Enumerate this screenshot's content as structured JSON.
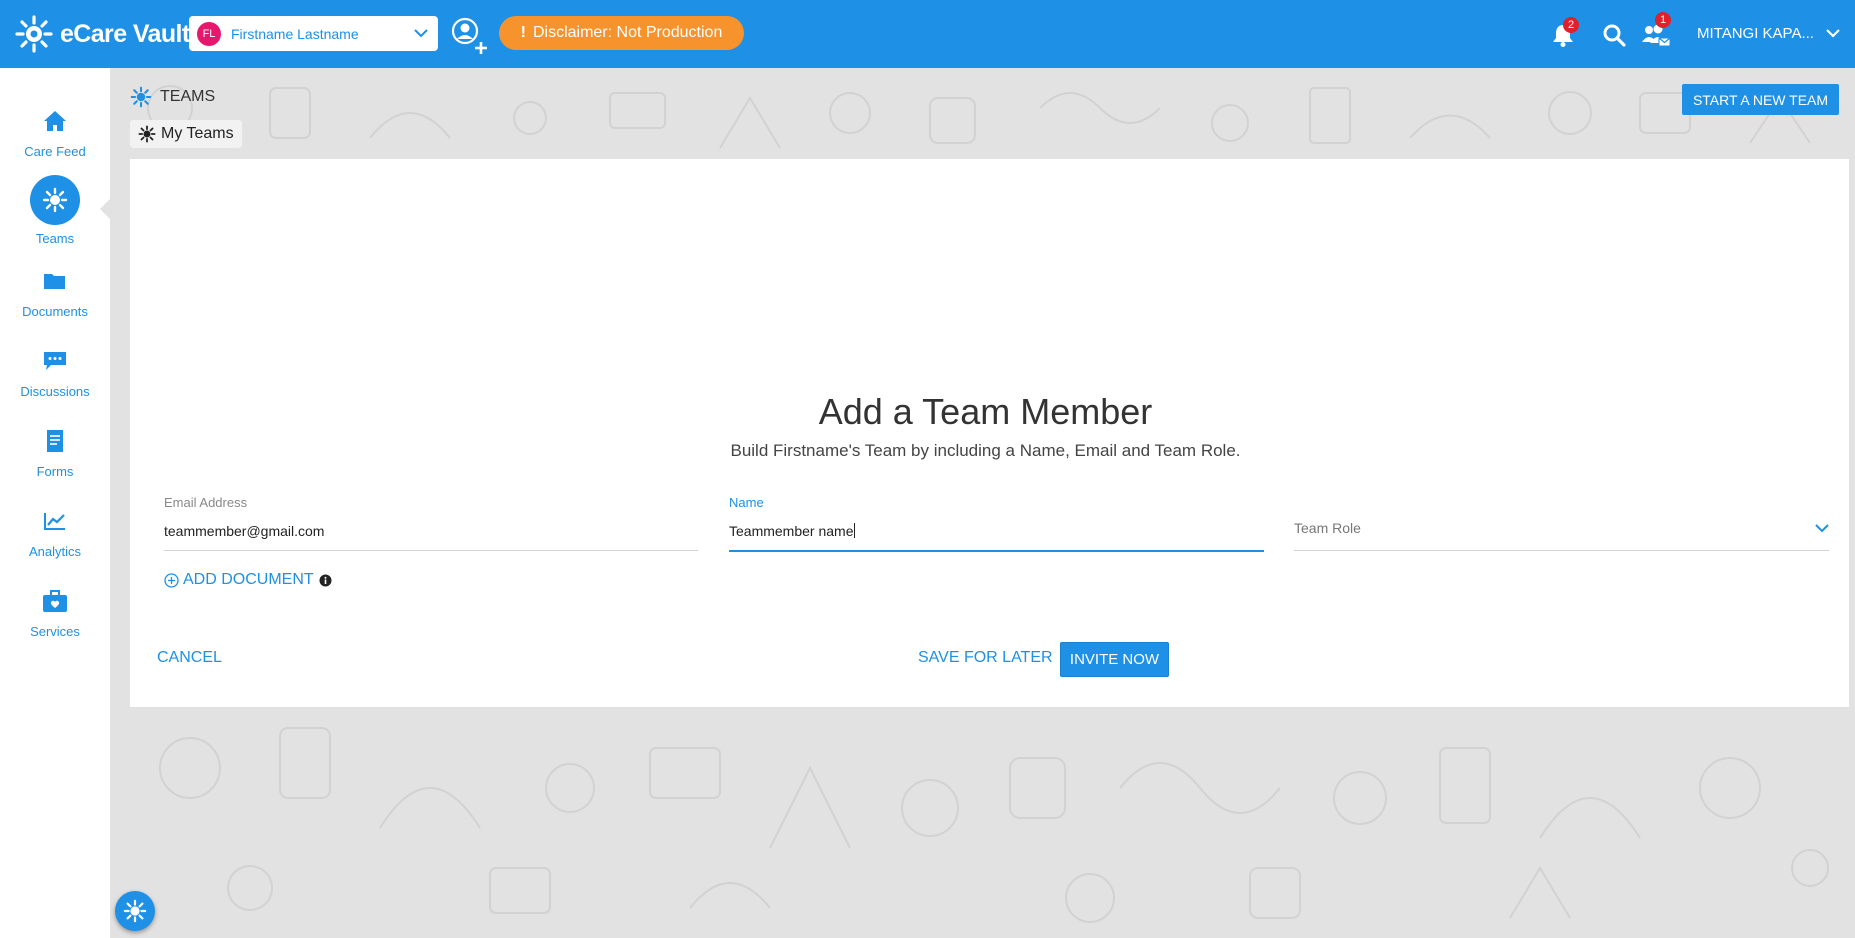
{
  "brand": {
    "name": "eCare Vault"
  },
  "header": {
    "patient": {
      "initials": "FL",
      "name": "Firstname Lastname"
    },
    "disclaimer": {
      "icon": "!",
      "text": "Disclaimer: Not Production"
    },
    "notifications": {
      "count": "2"
    },
    "invitations": {
      "count": "1"
    },
    "user": {
      "name": "MITANGI KAPA..."
    }
  },
  "sidebar": {
    "items": [
      {
        "label": "Care Feed",
        "icon": "home-icon"
      },
      {
        "label": "Teams",
        "icon": "teams-icon",
        "active": true
      },
      {
        "label": "Documents",
        "icon": "folder-icon"
      },
      {
        "label": "Discussions",
        "icon": "chat-icon"
      },
      {
        "label": "Forms",
        "icon": "form-icon"
      },
      {
        "label": "Analytics",
        "icon": "chart-icon"
      },
      {
        "label": "Services",
        "icon": "briefcase-icon"
      }
    ]
  },
  "page": {
    "title": "TEAMS",
    "breadcrumb": "My Teams",
    "start_team_label": "START A NEW TEAM"
  },
  "form": {
    "title": "Add a Team Member",
    "subtitle": "Build Firstname's Team by including a Name, Email and Team Role.",
    "email": {
      "label": "Email Address",
      "value": "teammember@gmail.com"
    },
    "name": {
      "label": "Name",
      "value": "Teammember name"
    },
    "role": {
      "label": "Team Role"
    },
    "add_document_label": "ADD DOCUMENT",
    "cancel_label": "CANCEL",
    "save_label": "SAVE FOR LATER",
    "invite_label": "INVITE NOW"
  },
  "colors": {
    "primary": "#1e90e6",
    "disclaimer": "#f7932c",
    "badge": "#e0202a",
    "avatar": "#e8176e"
  }
}
